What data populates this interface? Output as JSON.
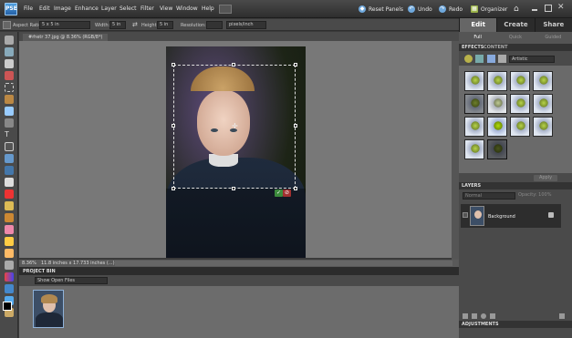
{
  "app": {
    "logo": "PSE"
  },
  "menu": [
    "File",
    "Edit",
    "Image",
    "Enhance",
    "Layer",
    "Select",
    "Filter",
    "View",
    "Window",
    "Help"
  ],
  "toolbar": {
    "reset_panels": "Reset Panels",
    "undo": "Undo",
    "redo": "Redo",
    "organizer": "Organizer",
    "home_icon": "home-icon"
  },
  "modes": {
    "tabs": [
      "Edit",
      "Create",
      "Share"
    ],
    "active": "Edit",
    "subtabs": [
      "Full",
      "Quick",
      "Guided"
    ],
    "active_sub": "Full"
  },
  "options": {
    "aspect_label": "Aspect Ratio:",
    "aspect_value": "5 x 5 in",
    "width_label": "Width:",
    "width_value": "5 in",
    "height_label": "Height:",
    "height_value": "5 in",
    "resolution_label": "Resolution:",
    "resolution_value": "",
    "res_unit": "pixels/inch"
  },
  "document": {
    "tab": "#rhetr 37.jpg @ 8.36% (RGB/8*)",
    "zoom": "8.36%",
    "size": "11.8 inches x 17.733 inches (...)"
  },
  "project_bin": {
    "title": "PROJECT BIN",
    "filter": "Show Open Files"
  },
  "effects": {
    "title": "EFFECTS",
    "content": "CONTENT",
    "category": "Artistic",
    "apply": "Apply",
    "count": 14
  },
  "layers": {
    "title": "LAYERS",
    "blend": "Normal",
    "opacity_label": "Opacity:",
    "opacity_value": "100%",
    "layer_name": "Background"
  },
  "adjustments": {
    "title": "ADJUSTMENTS"
  }
}
